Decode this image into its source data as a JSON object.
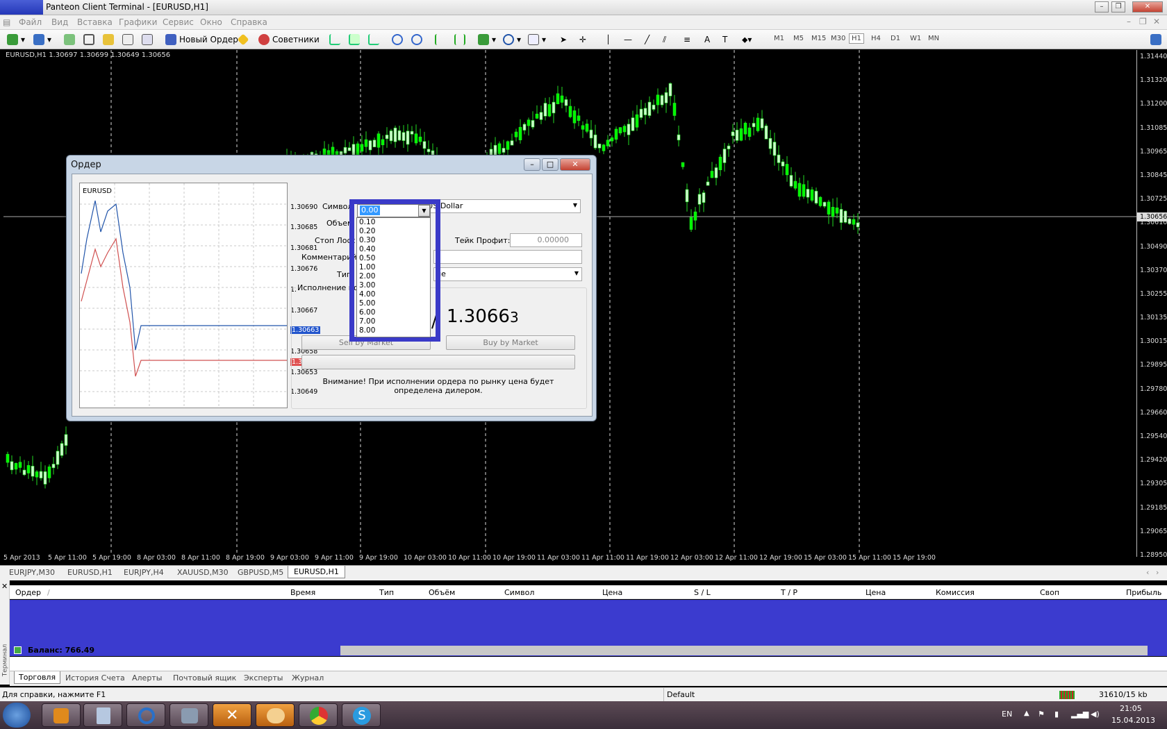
{
  "window": {
    "title": "Panteon Client Terminal - [EURUSD,H1]"
  },
  "menu": [
    "Файл",
    "Вид",
    "Вставка",
    "Графики",
    "Сервис",
    "Окно",
    "Справка"
  ],
  "toolbar": {
    "new_order": "Новый Ордер",
    "experts": "Советники",
    "timeframes": [
      "M1",
      "M5",
      "M15",
      "M30",
      "H1",
      "H4",
      "D1",
      "W1",
      "MN"
    ],
    "active_timeframe": "H1"
  },
  "chart": {
    "header": "EURUSD,H1  1.30697 1.30699 1.30649 1.30656",
    "price_labels": [
      "1.31440",
      "1.31320",
      "1.31200",
      "1.31085",
      "1.30965",
      "1.30845",
      "1.30725",
      "1.30610",
      "1.30490",
      "1.30370",
      "1.30255",
      "1.30135",
      "1.30015",
      "1.29895",
      "1.29780",
      "1.29660",
      "1.29540",
      "1.29420",
      "1.29305",
      "1.29185",
      "1.29065",
      "1.28950"
    ],
    "current_price": "1.30656",
    "time_labels": [
      "5 Apr 2013",
      "5 Apr 11:00",
      "5 Apr 19:00",
      "8 Apr 03:00",
      "8 Apr 11:00",
      "8 Apr 19:00",
      "9 Apr 03:00",
      "9 Apr 11:00",
      "9 Apr 19:00",
      "10 Apr 03:00",
      "10 Apr 11:00",
      "10 Apr 19:00",
      "11 Apr 03:00",
      "11 Apr 11:00",
      "11 Apr 19:00",
      "12 Apr 03:00",
      "12 Apr 11:00",
      "12 Apr 19:00",
      "15 Apr 03:00",
      "15 Apr 11:00",
      "15 Apr 19:00"
    ],
    "colors": {
      "bull": "#00ff00",
      "bear": "#ccffcc",
      "grid": "#dddddd"
    }
  },
  "order_dialog": {
    "title": "Ордер",
    "mini_chart": {
      "symbol": "EURUSD",
      "price_labels": [
        "1.30690",
        "1.30685",
        "1.30681",
        "1.30676",
        "1.30672",
        "1.30667",
        "1.30663",
        "1.30658",
        "1.30656",
        "1.30653",
        "1.30649"
      ],
      "ask_label": "1.30663",
      "bid_label": "1.30656"
    },
    "symbol_label": "Символ:",
    "symbol_value": "EURUSD, Euro vs US Dollar",
    "volume_label": "Объем",
    "volume_value": "0.00",
    "volume_options": [
      "0.10",
      "0.20",
      "0.30",
      "0.40",
      "0.50",
      "1.00",
      "2.00",
      "3.00",
      "4.00",
      "5.00",
      "6.00",
      "7.00",
      "8.00"
    ],
    "stop_loss_label": "Стоп Лосс",
    "take_profit_label": "Тейк Профит:",
    "take_profit_value": "0.00000",
    "comment_label": "Комментарий",
    "type_label": "Тип",
    "type_value": "ие",
    "execution_label": "Исполнение по",
    "ask_price": "1.3066",
    "ask_price_small": "3",
    "ask_prefix": "/",
    "sell_button": "Sell by Market",
    "buy_button": "Buy by Market",
    "warning": "Внимание! При исполнении ордера по рынку цена будет определена дилером."
  },
  "chart_tabs": [
    "EURJPY,M30",
    "EURUSD,H1",
    "EURJPY,H4",
    "XAUUSD,M30",
    "GBPUSD,M5",
    "EURUSD,H1"
  ],
  "terminal": {
    "columns": [
      "Ордер",
      "/",
      "Время",
      "Тип",
      "Объём",
      "Символ",
      "Цена",
      "S / L",
      "T / P",
      "Цена",
      "Комиссия",
      "Своп",
      "Прибыль"
    ],
    "balance": "Баланс: 766.49",
    "tabs": [
      "Торговля",
      "История Счета",
      "Алерты",
      "Почтовый ящик",
      "Эксперты",
      "Журнал"
    ],
    "side_label": "Терминал"
  },
  "status": {
    "help": "Для справки, нажмите F1",
    "profile": "Default",
    "traffic": "31610/15 kb"
  },
  "taskbar": {
    "lang": "EN",
    "time": "21:05",
    "date": "15.04.2013"
  }
}
